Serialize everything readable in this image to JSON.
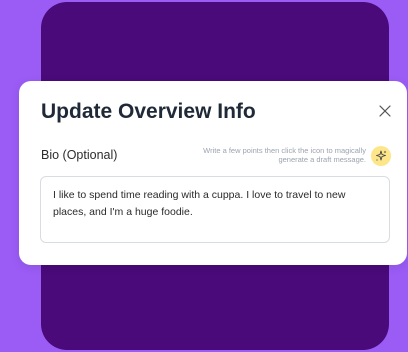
{
  "modal": {
    "title": "Update Overview Info",
    "close_icon": "close-icon"
  },
  "bio": {
    "label": "Bio (Optional)",
    "hint": "Write a few points then click the icon to magically generate a draft message.",
    "magic_icon": "sparkle-icon",
    "value": "I like to spend time reading with a cuppa. I love to travel to new places, and I'm a huge foodie."
  },
  "colors": {
    "background": "#9b5cf6",
    "panel": "#4a0a7a",
    "magic_button": "#fde68a"
  }
}
